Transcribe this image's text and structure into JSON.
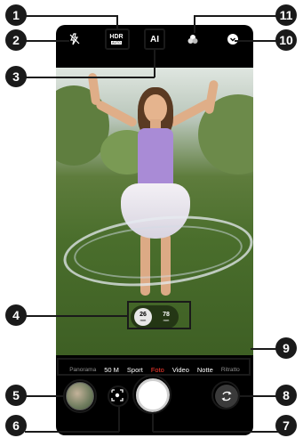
{
  "top_bar": {
    "flash": {
      "icon": "flash-off-icon"
    },
    "hdr": {
      "label": "HDR",
      "sub_label": "AUTO"
    },
    "ai": {
      "label": "AI"
    },
    "filters": {
      "icon": "filters-icon"
    },
    "more": {
      "icon": "chevron-down-icon"
    }
  },
  "zoom": {
    "options": [
      {
        "value": "26",
        "unit": "mm",
        "selected": true
      },
      {
        "value": "78",
        "unit": "mm",
        "selected": false
      }
    ]
  },
  "modes": {
    "items": [
      "Panorama",
      "50 M",
      "Sport",
      "Foto",
      "Video",
      "Notte",
      "Ritratto"
    ],
    "active": "Foto"
  },
  "bottom_bar": {
    "gallery": {
      "icon": "gallery-thumbnail"
    },
    "lens": {
      "icon": "google-lens-icon"
    },
    "shutter": {
      "icon": "shutter-button"
    },
    "switch_camera": {
      "icon": "switch-camera-icon"
    }
  },
  "callouts": [
    "1",
    "2",
    "3",
    "4",
    "5",
    "6",
    "7",
    "8",
    "9",
    "10",
    "11"
  ],
  "colors": {
    "active_mode": "#ff3b30",
    "callout": "#1a1a1a"
  }
}
